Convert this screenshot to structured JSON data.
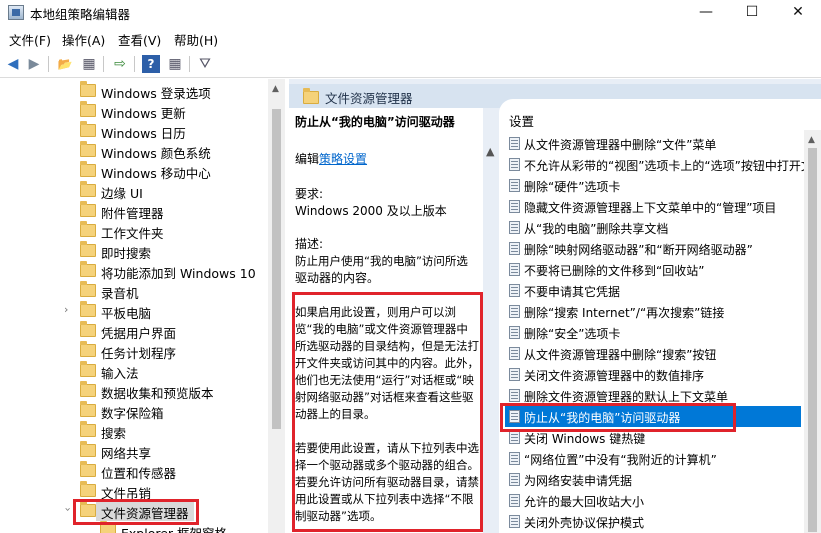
{
  "window": {
    "title": "本地组策略编辑器",
    "minimize": "—",
    "maximize": "☐",
    "close": "✕"
  },
  "menu": [
    "文件(F)",
    "操作(A)",
    "查看(V)",
    "帮助(H)"
  ],
  "toolbar": {
    "back": "◀",
    "forward": "▶",
    "up": "📂",
    "view": "▦",
    "export": "⇨",
    "help": "?",
    "filter": "⛛"
  },
  "tree": {
    "items": [
      "Windows 登录选项",
      "Windows 更新",
      "Windows 日历",
      "Windows 颜色系统",
      "Windows 移动中心",
      "边缘 UI",
      "附件管理器",
      "工作文件夹",
      "即时搜索",
      "将功能添加到 Windows 10",
      "录音机",
      "平板电脑",
      "凭据用户界面",
      "任务计划程序",
      "输入法",
      "数据收集和预览版本",
      "数字保险箱",
      "搜索",
      "网络共享",
      "位置和传感器",
      "文件吊销",
      "文件资源管理器",
      "Explorer 框架窗格"
    ],
    "expandable_index": 11,
    "selected_index": 21
  },
  "folder_header": "文件资源管理器",
  "description": {
    "title": "防止从“我的电脑”访问驱动器",
    "edit_prefix": "编辑",
    "edit_link": "策略设置",
    "requirements_label": "要求:",
    "requirements_value": "Windows 2000 及以上版本",
    "desc_label": "描述:",
    "desc_line1": "防止用户使用“我的电脑”访问所选",
    "desc_line2": "驱动器的内容。",
    "para1": "如果启用此设置，则用户可以浏览“我的电脑”或文件资源管理器中所选驱动器的目录结构，但是无法打开文件夹或访问其中的内容。此外，他们也无法使用“运行”对话框或“映射网络驱动器”对话框来查看这些驱动器上的目录。",
    "para2": "若要使用此设置，请从下拉列表中选择一个驱动器或多个驱动器的组合。若要允许访问所有驱动器目录，请禁用此设置或从下拉列表中选择“不限制驱动器”选项。"
  },
  "settings": {
    "column_header": "设置",
    "items": [
      "从文件资源管理器中删除“文件”菜单",
      "不允许从彩带的“视图”选项卡上的“选项”按钮中打开文",
      "删除“硬件”选项卡",
      "隐藏文件资源管理器上下文菜单中的“管理”项目",
      "从“我的电脑”删除共享文档",
      "删除“映射网络驱动器”和“断开网络驱动器”",
      "不要将已删除的文件移到“回收站”",
      "不要申请其它凭据",
      "删除“搜索 Internet”/“再次搜索”链接",
      "删除“安全”选项卡",
      "从文件资源管理器中删除“搜索”按钮",
      "关闭文件资源管理器中的数值排序",
      "删除文件资源管理器的默认上下文菜单",
      "防止从“我的电脑”访问驱动器",
      "关闭 Windows 键热键",
      "“网络位置”中没有“我附近的计算机”",
      "为网络安装申请凭据",
      "允许的最大回收站大小",
      "关闭外壳协议保护模式"
    ],
    "selected_index": 13
  },
  "colors": {
    "highlight_red": "#e0232b",
    "selection_blue": "#0078d7",
    "link_blue": "#0066cc"
  }
}
